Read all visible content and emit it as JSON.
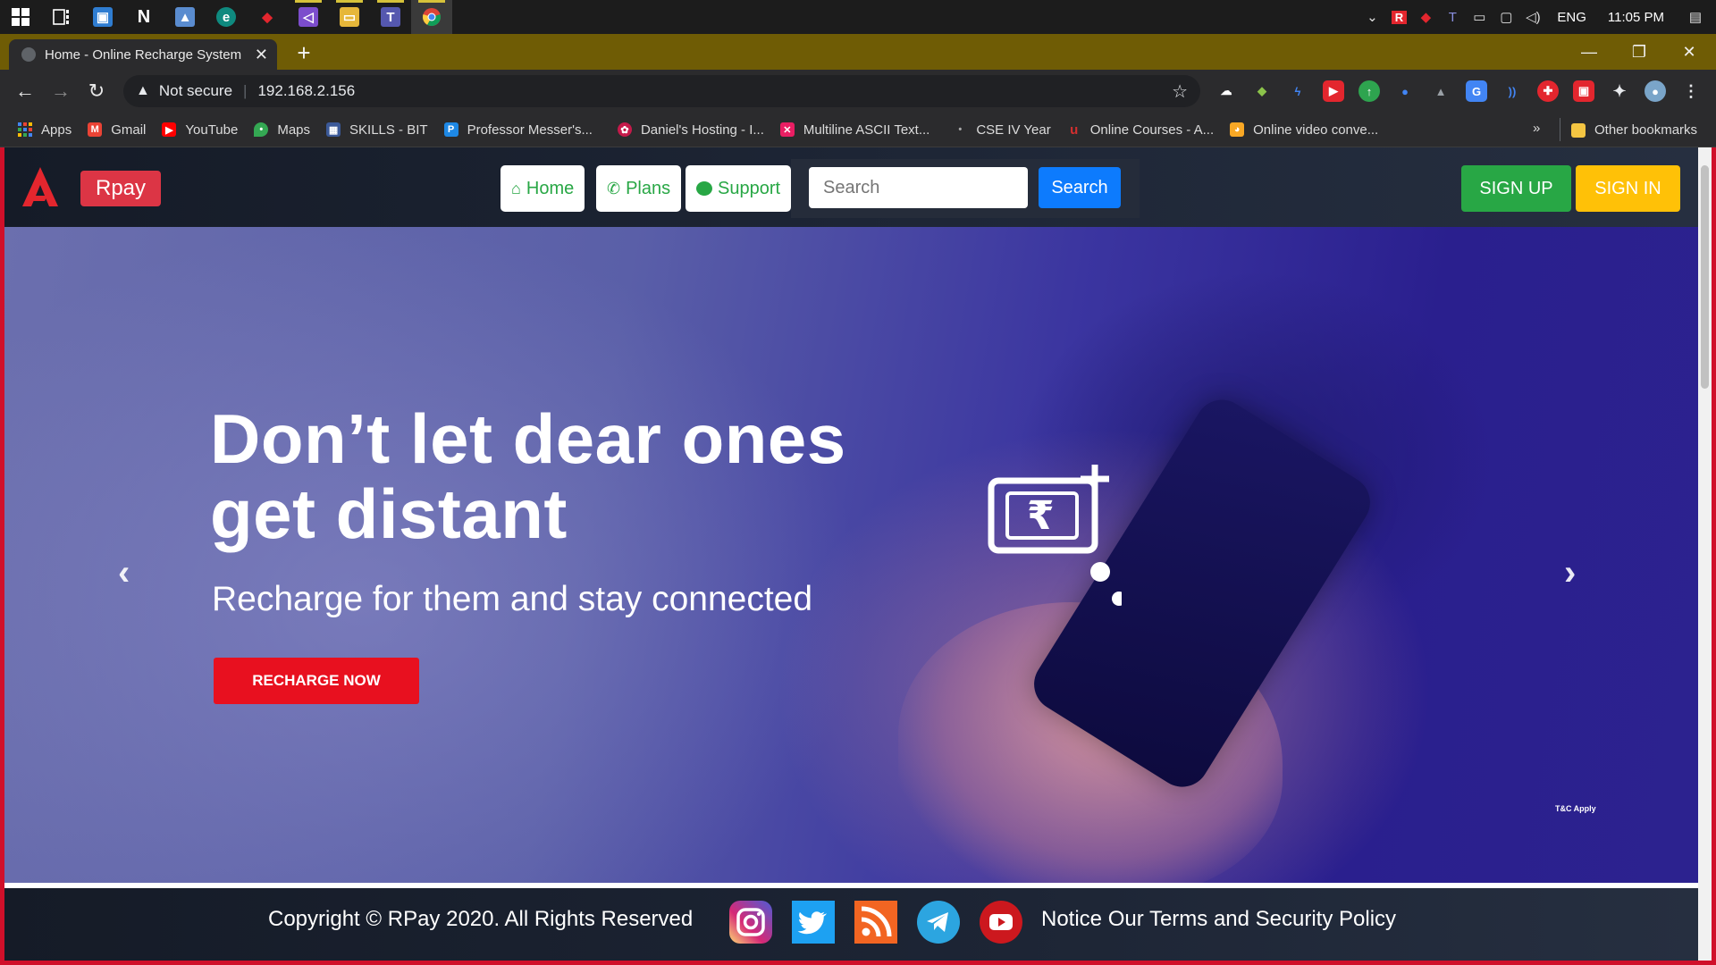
{
  "taskbar": {
    "apps": [
      "windows-start",
      "task-view",
      "remote-desktop",
      "notion",
      "photos",
      "edge",
      "app-red",
      "visual-studio",
      "file-explorer",
      "teams",
      "chrome"
    ],
    "tray": {
      "lang": "ENG",
      "time": "11:05 PM"
    }
  },
  "browser": {
    "tab_title": "Home - Online Recharge System",
    "security_label": "Not secure",
    "url": "192.168.2.156",
    "bookmarks": [
      {
        "label": "Apps",
        "icon": "apps-grid-icon",
        "color": "#4285f4"
      },
      {
        "label": "Gmail",
        "icon": "gmail-icon",
        "color": "#ea4335"
      },
      {
        "label": "YouTube",
        "icon": "youtube-icon",
        "color": "#ff0000"
      },
      {
        "label": "Maps",
        "icon": "maps-icon",
        "color": "#34a853"
      },
      {
        "label": "SKILLS - BIT",
        "icon": "skills-icon",
        "color": "#3b5998"
      },
      {
        "label": "Professor Messer's...",
        "icon": "professor-messer-icon",
        "color": "#1e88e5"
      },
      {
        "label": "Daniel's Hosting - I...",
        "icon": "raspberry-icon",
        "color": "#c51a4a"
      },
      {
        "label": "Multiline ASCII Text...",
        "icon": "butterfly-icon",
        "color": "#e91e63"
      },
      {
        "label": "CSE IV Year",
        "icon": "dot-icon",
        "color": "#888888"
      },
      {
        "label": "Online Courses - A...",
        "icon": "udemy-icon",
        "color": "#d32f2f"
      },
      {
        "label": "Online video conve...",
        "icon": "video-converter-icon",
        "color": "#f9a825"
      }
    ],
    "more_label": "»",
    "other_bookmarks": "Other bookmarks"
  },
  "site": {
    "brand": "Rpay",
    "nav": [
      {
        "label": "Home",
        "icon": "home-icon"
      },
      {
        "label": "Plans",
        "icon": "phone-icon"
      },
      {
        "label": "Support",
        "icon": "chat-icon"
      }
    ],
    "search": {
      "placeholder": "Search",
      "button": "Search"
    },
    "signup": "SIGN UP",
    "signin": "SIGN IN"
  },
  "hero": {
    "headline": "Don’t let dear ones get distant",
    "subline": "Recharge for them and stay connected",
    "cta": "RECHARGE NOW",
    "tnc": "T&C Apply",
    "slides_count": 4,
    "active_slide": 3
  },
  "footer": {
    "copyright": "Copyright © RPay 2020. All Rights Reserved",
    "social": [
      "instagram",
      "twitter",
      "rss",
      "telegram",
      "youtube"
    ],
    "notice": "Notice Our Terms and Security Policy"
  },
  "colors": {
    "danger": "#dc3545",
    "success": "#28a745",
    "warning": "#ffc107",
    "primary": "#0d7bfd",
    "tabbar": "#6f5c05"
  }
}
